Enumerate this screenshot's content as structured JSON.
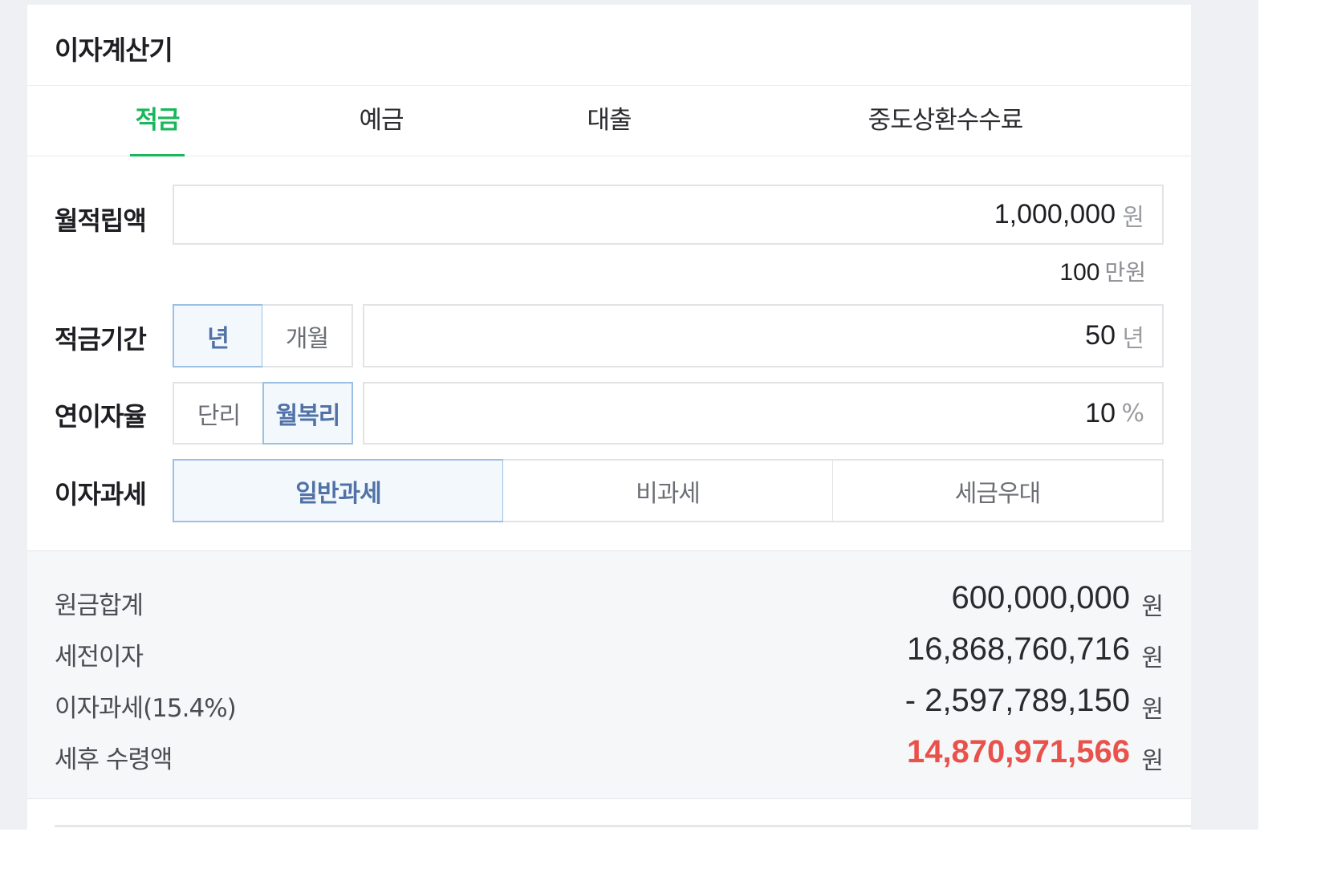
{
  "app": {
    "title": "이자계산기"
  },
  "tabs": [
    {
      "label": "적금",
      "active": true
    },
    {
      "label": "예금",
      "active": false
    },
    {
      "label": "대출",
      "active": false
    },
    {
      "label": "중도상환수수료",
      "active": false
    }
  ],
  "form": {
    "monthly_deposit": {
      "label": "월적립액",
      "value": "1,000,000",
      "unit": "원",
      "hint_value": "100",
      "hint_unit": "만원"
    },
    "period": {
      "label": "적금기간",
      "options": [
        "년",
        "개월"
      ],
      "selected": "년",
      "value": "50",
      "unit": "년"
    },
    "rate": {
      "label": "연이자율",
      "options": [
        "단리",
        "월복리"
      ],
      "selected": "월복리",
      "value": "10",
      "unit": "%"
    },
    "tax": {
      "label": "이자과세",
      "options": [
        "일반과세",
        "비과세",
        "세금우대"
      ],
      "selected": "일반과세"
    }
  },
  "results": [
    {
      "label": "원금합계",
      "value": "600,000,000",
      "unit": "원",
      "emphasis": false
    },
    {
      "label": "세전이자",
      "value": "16,868,760,716",
      "unit": "원",
      "emphasis": false
    },
    {
      "label": "이자과세(15.4%)",
      "value": "- 2,597,789,150",
      "unit": "원",
      "emphasis": false
    },
    {
      "label": "세후 수령액",
      "value": "14,870,971,566",
      "unit": "원",
      "emphasis": true
    }
  ],
  "colors": {
    "accent_green": "#19b65b",
    "selected_blue": "#5072a6",
    "emphasis_red": "#e8524a"
  }
}
